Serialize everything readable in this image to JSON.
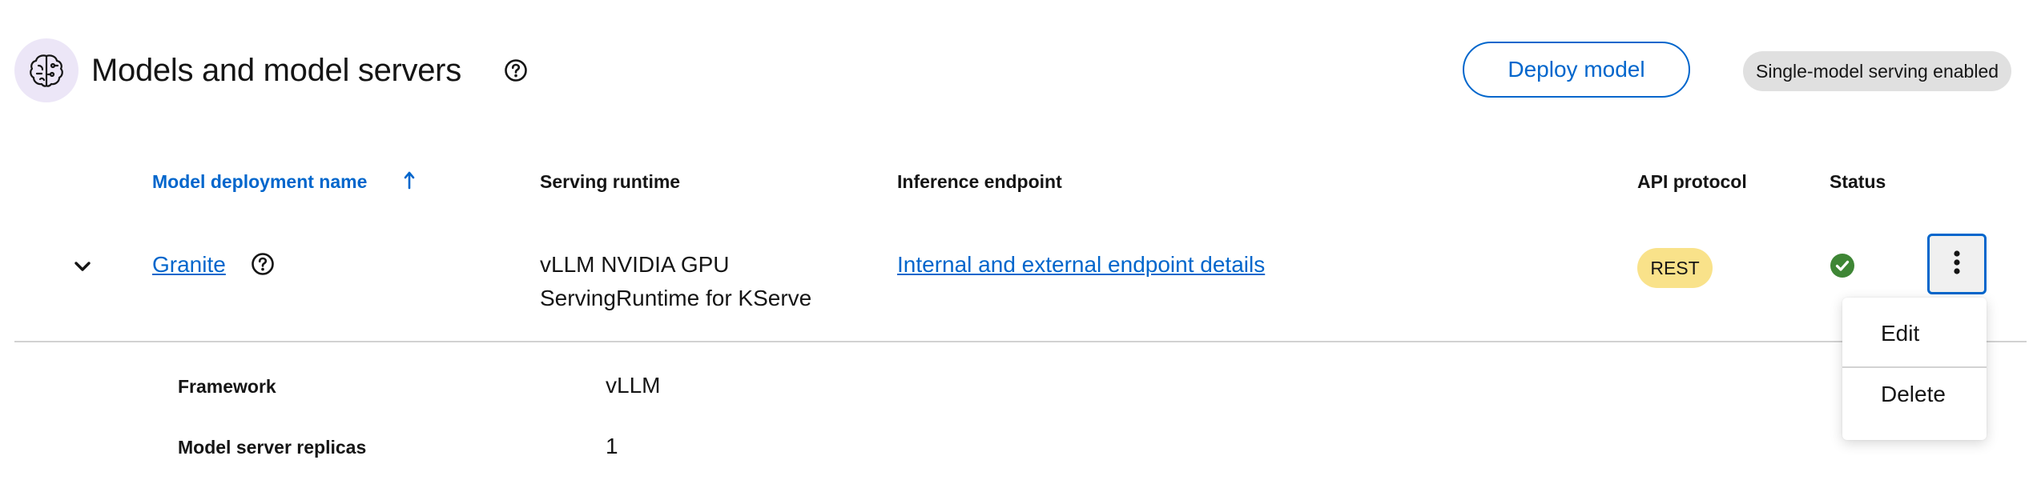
{
  "header": {
    "title": "Models and model servers",
    "deploy_label": "Deploy model",
    "serving_badge": "Single-model serving enabled"
  },
  "table": {
    "columns": {
      "name": "Model deployment name",
      "runtime": "Serving runtime",
      "endpoint": "Inference endpoint",
      "protocol": "API protocol",
      "status": "Status"
    },
    "rows": [
      {
        "name": "Granite",
        "runtime_line1": "vLLM NVIDIA GPU",
        "runtime_line2": "ServingRuntime for KServe",
        "endpoint": "Internal and external endpoint details",
        "protocol": "REST",
        "status": "success",
        "details": {
          "framework_label": "Framework",
          "framework_value": "vLLM",
          "replicas_label": "Model server replicas",
          "replicas_value": "1"
        }
      }
    ]
  },
  "kebab_menu": {
    "items": [
      "Edit",
      "Delete"
    ]
  },
  "icons": {
    "title": "brain-circuit-icon",
    "help": "help-circle-icon",
    "sort": "arrow-up-icon",
    "expand": "chevron-down-icon",
    "status": "check-circle-icon",
    "kebab": "ellipsis-vertical-icon"
  },
  "colors": {
    "accent": "#0066cc",
    "success": "#3e8635",
    "rest_badge": "#f9e28a",
    "title_icon_bg": "#ece6f7"
  }
}
